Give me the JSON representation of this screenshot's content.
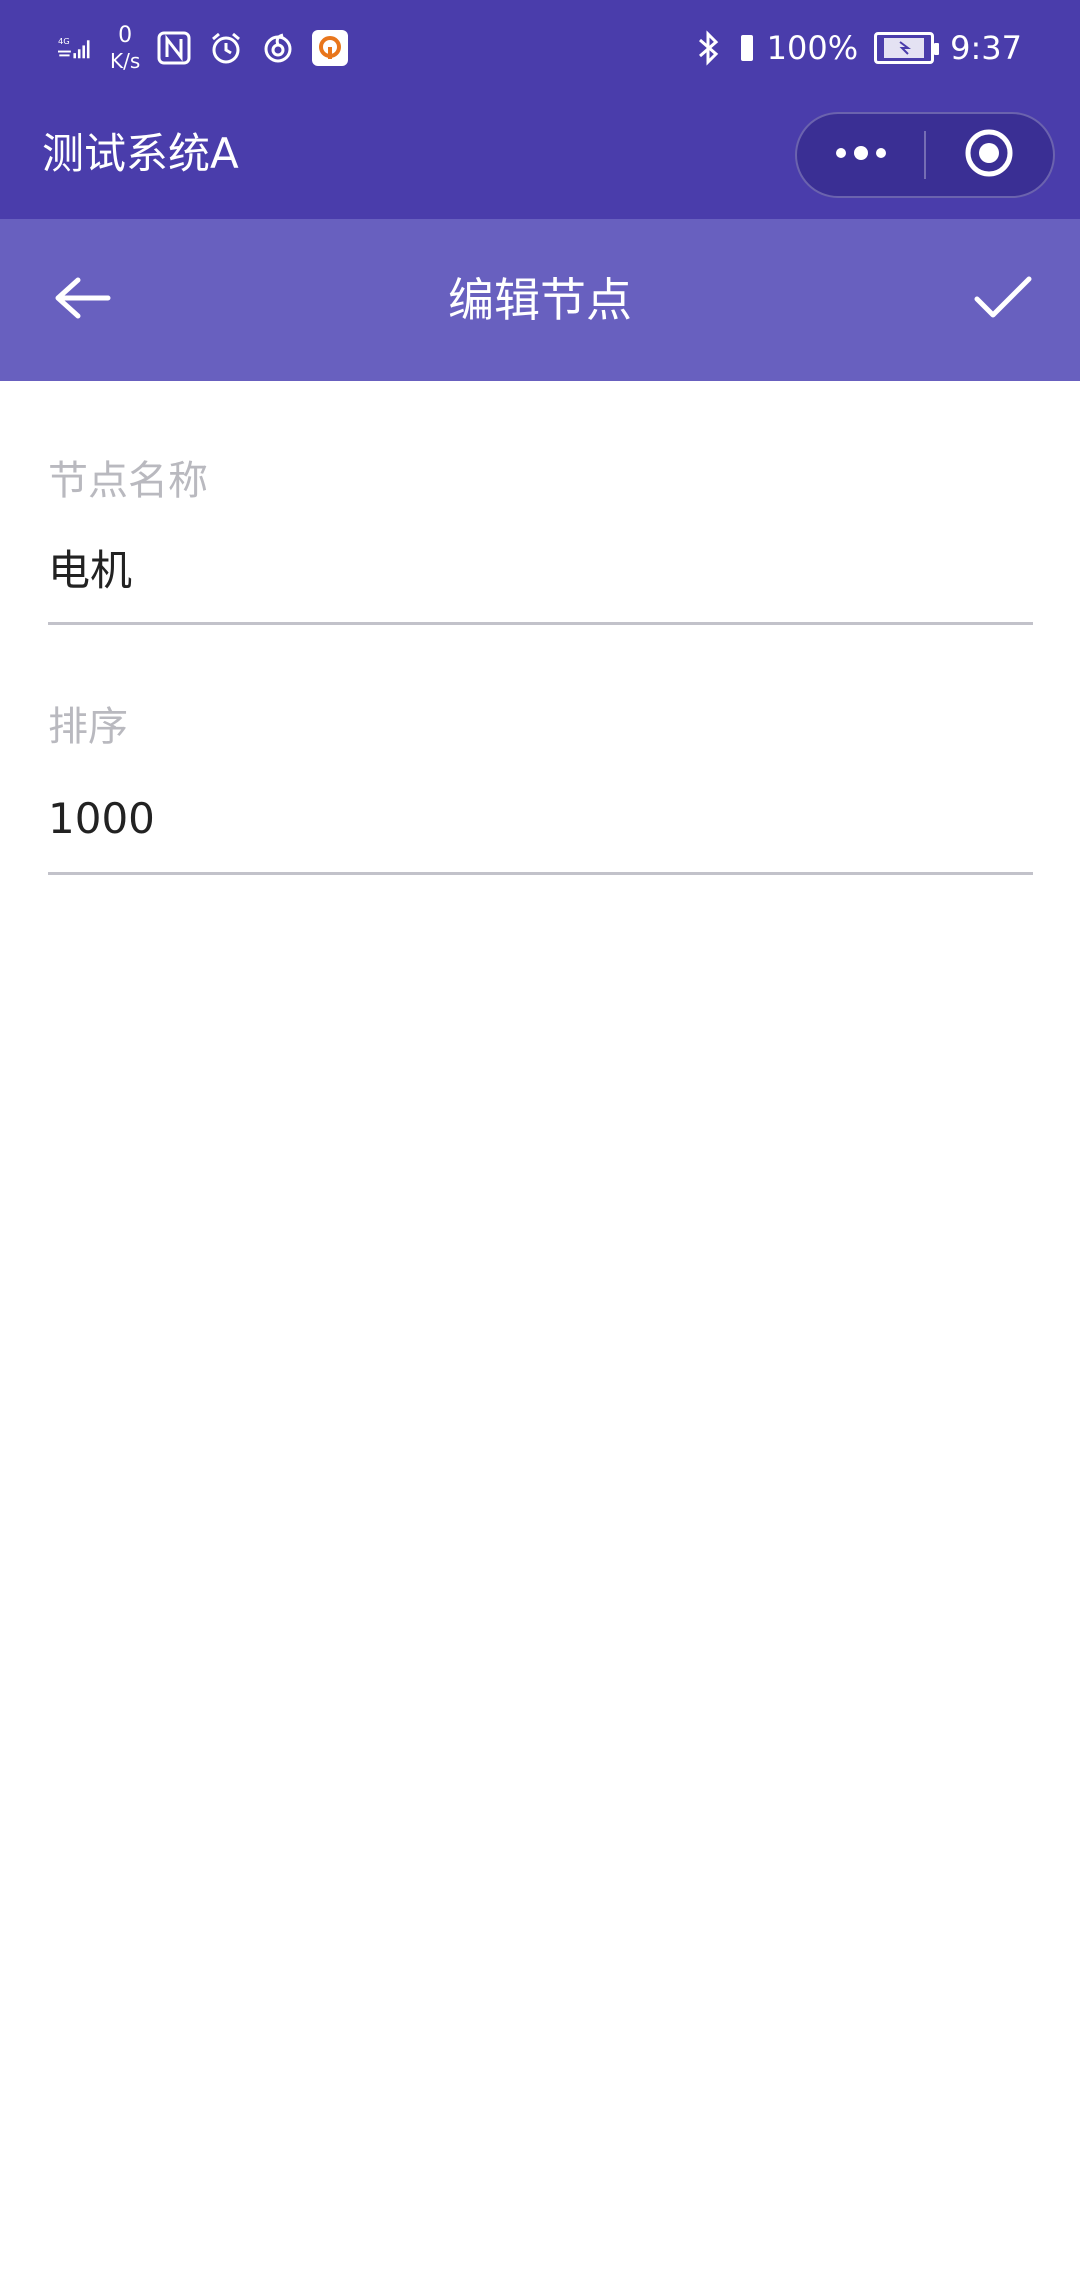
{
  "status_bar": {
    "signal": "4G",
    "net_speed_value": "0",
    "net_speed_unit": "K/s",
    "battery": "100%",
    "time": "9:37",
    "icons": [
      "signal-icon",
      "nfc-icon",
      "alarm-icon",
      "netease-music-icon",
      "app-notification-icon",
      "bluetooth-icon",
      "vibrate-icon",
      "battery-icon"
    ]
  },
  "app": {
    "title": "测试系统A",
    "capsule": {
      "more_icon": "more-dots-icon",
      "close_icon": "target-close-icon"
    }
  },
  "navbar": {
    "title": "编辑节点",
    "back_icon": "arrow-left-icon",
    "confirm_icon": "checkmark-icon"
  },
  "form": {
    "fields": [
      {
        "label": "节点名称",
        "value": "电机"
      },
      {
        "label": "排序",
        "value": "1000"
      }
    ]
  },
  "colors": {
    "header_bg": "#4a3dab",
    "navbar_bg": "#6860bf",
    "label_color": "#b9b9bf",
    "value_color": "#222222",
    "divider_color": "#c2c2ca"
  }
}
